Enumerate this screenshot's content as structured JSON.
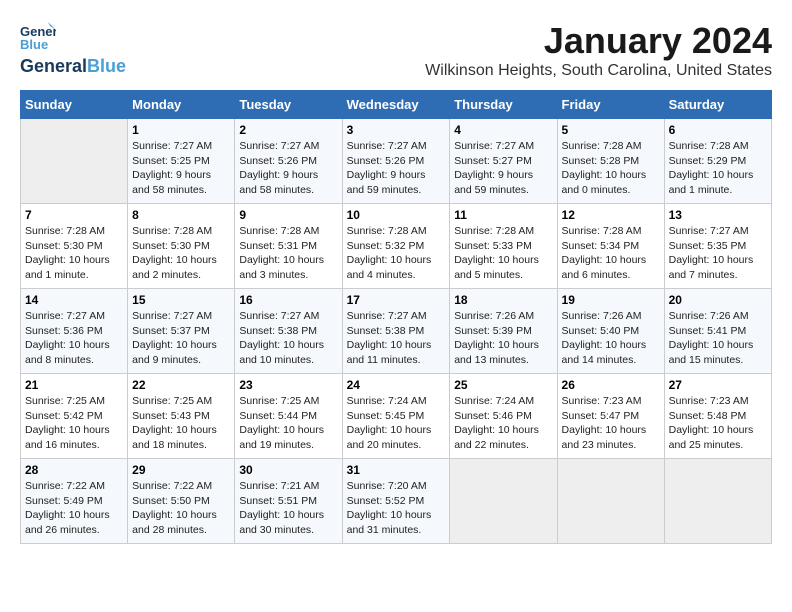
{
  "header": {
    "logo_general": "General",
    "logo_blue": "Blue",
    "title": "January 2024",
    "subtitle": "Wilkinson Heights, South Carolina, United States"
  },
  "calendar": {
    "days_of_week": [
      "Sunday",
      "Monday",
      "Tuesday",
      "Wednesday",
      "Thursday",
      "Friday",
      "Saturday"
    ],
    "weeks": [
      [
        {
          "day": "",
          "info": ""
        },
        {
          "day": "1",
          "info": "Sunrise: 7:27 AM\nSunset: 5:25 PM\nDaylight: 9 hours\nand 58 minutes."
        },
        {
          "day": "2",
          "info": "Sunrise: 7:27 AM\nSunset: 5:26 PM\nDaylight: 9 hours\nand 58 minutes."
        },
        {
          "day": "3",
          "info": "Sunrise: 7:27 AM\nSunset: 5:26 PM\nDaylight: 9 hours\nand 59 minutes."
        },
        {
          "day": "4",
          "info": "Sunrise: 7:27 AM\nSunset: 5:27 PM\nDaylight: 9 hours\nand 59 minutes."
        },
        {
          "day": "5",
          "info": "Sunrise: 7:28 AM\nSunset: 5:28 PM\nDaylight: 10 hours\nand 0 minutes."
        },
        {
          "day": "6",
          "info": "Sunrise: 7:28 AM\nSunset: 5:29 PM\nDaylight: 10 hours\nand 1 minute."
        }
      ],
      [
        {
          "day": "7",
          "info": "Sunrise: 7:28 AM\nSunset: 5:30 PM\nDaylight: 10 hours\nand 1 minute."
        },
        {
          "day": "8",
          "info": "Sunrise: 7:28 AM\nSunset: 5:30 PM\nDaylight: 10 hours\nand 2 minutes."
        },
        {
          "day": "9",
          "info": "Sunrise: 7:28 AM\nSunset: 5:31 PM\nDaylight: 10 hours\nand 3 minutes."
        },
        {
          "day": "10",
          "info": "Sunrise: 7:28 AM\nSunset: 5:32 PM\nDaylight: 10 hours\nand 4 minutes."
        },
        {
          "day": "11",
          "info": "Sunrise: 7:28 AM\nSunset: 5:33 PM\nDaylight: 10 hours\nand 5 minutes."
        },
        {
          "day": "12",
          "info": "Sunrise: 7:28 AM\nSunset: 5:34 PM\nDaylight: 10 hours\nand 6 minutes."
        },
        {
          "day": "13",
          "info": "Sunrise: 7:27 AM\nSunset: 5:35 PM\nDaylight: 10 hours\nand 7 minutes."
        }
      ],
      [
        {
          "day": "14",
          "info": "Sunrise: 7:27 AM\nSunset: 5:36 PM\nDaylight: 10 hours\nand 8 minutes."
        },
        {
          "day": "15",
          "info": "Sunrise: 7:27 AM\nSunset: 5:37 PM\nDaylight: 10 hours\nand 9 minutes."
        },
        {
          "day": "16",
          "info": "Sunrise: 7:27 AM\nSunset: 5:38 PM\nDaylight: 10 hours\nand 10 minutes."
        },
        {
          "day": "17",
          "info": "Sunrise: 7:27 AM\nSunset: 5:38 PM\nDaylight: 10 hours\nand 11 minutes."
        },
        {
          "day": "18",
          "info": "Sunrise: 7:26 AM\nSunset: 5:39 PM\nDaylight: 10 hours\nand 13 minutes."
        },
        {
          "day": "19",
          "info": "Sunrise: 7:26 AM\nSunset: 5:40 PM\nDaylight: 10 hours\nand 14 minutes."
        },
        {
          "day": "20",
          "info": "Sunrise: 7:26 AM\nSunset: 5:41 PM\nDaylight: 10 hours\nand 15 minutes."
        }
      ],
      [
        {
          "day": "21",
          "info": "Sunrise: 7:25 AM\nSunset: 5:42 PM\nDaylight: 10 hours\nand 16 minutes."
        },
        {
          "day": "22",
          "info": "Sunrise: 7:25 AM\nSunset: 5:43 PM\nDaylight: 10 hours\nand 18 minutes."
        },
        {
          "day": "23",
          "info": "Sunrise: 7:25 AM\nSunset: 5:44 PM\nDaylight: 10 hours\nand 19 minutes."
        },
        {
          "day": "24",
          "info": "Sunrise: 7:24 AM\nSunset: 5:45 PM\nDaylight: 10 hours\nand 20 minutes."
        },
        {
          "day": "25",
          "info": "Sunrise: 7:24 AM\nSunset: 5:46 PM\nDaylight: 10 hours\nand 22 minutes."
        },
        {
          "day": "26",
          "info": "Sunrise: 7:23 AM\nSunset: 5:47 PM\nDaylight: 10 hours\nand 23 minutes."
        },
        {
          "day": "27",
          "info": "Sunrise: 7:23 AM\nSunset: 5:48 PM\nDaylight: 10 hours\nand 25 minutes."
        }
      ],
      [
        {
          "day": "28",
          "info": "Sunrise: 7:22 AM\nSunset: 5:49 PM\nDaylight: 10 hours\nand 26 minutes."
        },
        {
          "day": "29",
          "info": "Sunrise: 7:22 AM\nSunset: 5:50 PM\nDaylight: 10 hours\nand 28 minutes."
        },
        {
          "day": "30",
          "info": "Sunrise: 7:21 AM\nSunset: 5:51 PM\nDaylight: 10 hours\nand 30 minutes."
        },
        {
          "day": "31",
          "info": "Sunrise: 7:20 AM\nSunset: 5:52 PM\nDaylight: 10 hours\nand 31 minutes."
        },
        {
          "day": "",
          "info": ""
        },
        {
          "day": "",
          "info": ""
        },
        {
          "day": "",
          "info": ""
        }
      ]
    ]
  }
}
